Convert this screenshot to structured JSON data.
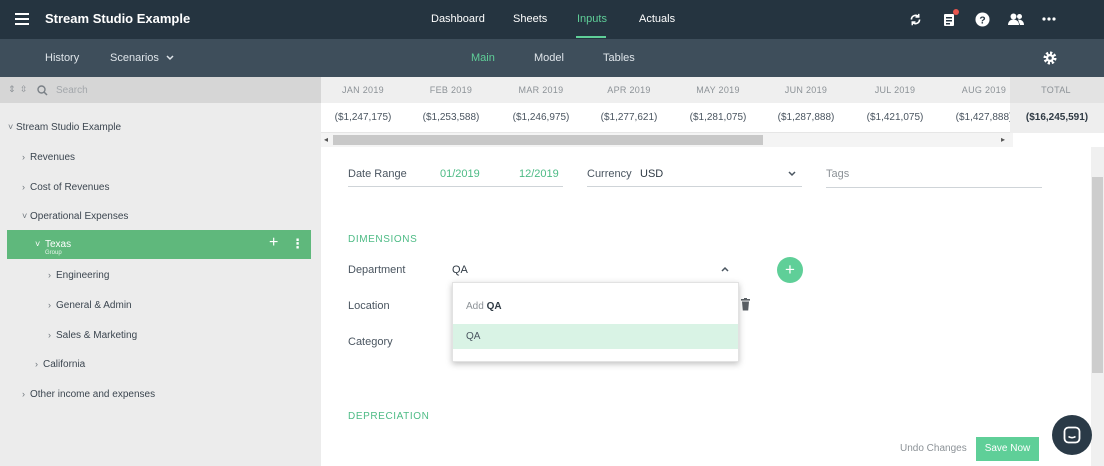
{
  "app": {
    "title": "Stream Studio Example"
  },
  "topnav": {
    "items": [
      {
        "label": "Dashboard"
      },
      {
        "label": "Sheets"
      },
      {
        "label": "Inputs",
        "active": true
      },
      {
        "label": "Actuals"
      }
    ]
  },
  "top_icons": [
    "sync-icon",
    "clipboard-icon",
    "help-icon",
    "users-icon",
    "more-icon"
  ],
  "subnav": {
    "history": "History",
    "scenarios": "Scenarios",
    "tabs": [
      {
        "label": "Main",
        "active": true
      },
      {
        "label": "Model"
      },
      {
        "label": "Tables"
      }
    ]
  },
  "sidebar": {
    "search_placeholder": "Search",
    "tree": {
      "root": "Stream Studio Example",
      "revenues": "Revenues",
      "cost_of_revenues": "Cost of Revenues",
      "operational_expenses": "Operational Expenses",
      "texas": "Texas",
      "texas_sub": "Group",
      "engineering": "Engineering",
      "general_admin": "General & Admin",
      "sales_marketing": "Sales & Marketing",
      "california": "California",
      "other": "Other income and expenses"
    }
  },
  "timeline": {
    "months": [
      "JAN 2019",
      "FEB 2019",
      "MAR 2019",
      "APR 2019",
      "MAY 2019",
      "JUN 2019",
      "JUL 2019",
      "AUG 2019"
    ],
    "total_label": "TOTAL",
    "values": [
      "($1,247,175)",
      "($1,253,588)",
      "($1,246,975)",
      "($1,277,621)",
      "($1,281,075)",
      "($1,287,888)",
      "($1,421,075)",
      "($1,427,888)"
    ],
    "total_value": "($16,245,591)"
  },
  "form": {
    "date_range_label": "Date Range",
    "date_start": "01/2019",
    "date_end": "12/2019",
    "currency_label": "Currency",
    "currency_value": "USD",
    "tags_label": "Tags",
    "dimensions_title": "DIMENSIONS",
    "department_label": "Department",
    "department_value": "QA",
    "location_label": "Location",
    "category_label": "Category",
    "depreciation_title": "DEPRECIATION",
    "dropdown": {
      "add_prefix": "Add",
      "add_value": "QA",
      "option": "QA"
    }
  },
  "footer": {
    "undo": "Undo Changes",
    "save": "Save Now"
  },
  "colors": {
    "accent": "#5fcf98",
    "topbar": "#253440",
    "subbar": "#3e4e5b",
    "selected_row": "#5fb87c"
  }
}
